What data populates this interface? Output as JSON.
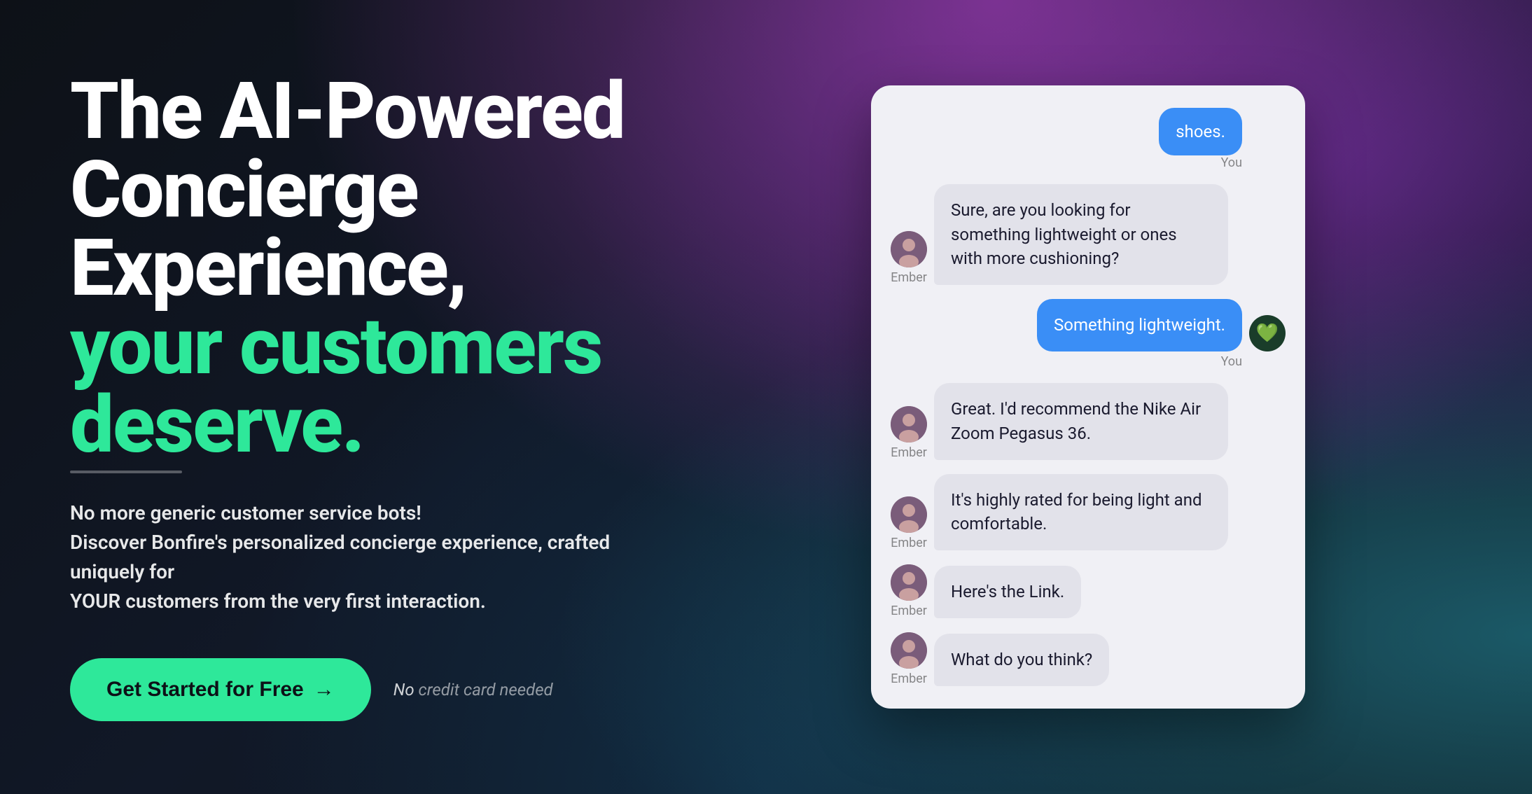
{
  "background": {
    "color": "#0d1117"
  },
  "hero": {
    "headline_line1": "The AI-Powered",
    "headline_line2": "Concierge",
    "headline_line3": "Experience,",
    "headline_green_line1": "your customers",
    "headline_green_line2": "deserve.",
    "subtext_line1": "No more generic customer service bots!",
    "subtext_line2": "Discover Bonfire's personalized concierge experience, crafted uniquely for",
    "subtext_line3": "YOUR customers from the very first interaction.",
    "cta_button_label": "Get Started for Free",
    "cta_arrow": "→",
    "no_cc_text": "No credit card needed"
  },
  "chat": {
    "messages": [
      {
        "type": "user",
        "text": "shoes.",
        "label": "You"
      },
      {
        "type": "bot",
        "text": "Sure, are you looking for something lightweight or ones with more cushioning?",
        "label": "Ember"
      },
      {
        "type": "user",
        "text": "Something lightweight.",
        "label": "You"
      },
      {
        "type": "bot",
        "text": "Great. I'd recommend the Nike Air Zoom Pegasus 36.",
        "label": "Ember"
      },
      {
        "type": "bot",
        "text": "It's highly rated for being light and comfortable.",
        "label": "Ember"
      },
      {
        "type": "bot",
        "text": "Here's the Link.",
        "label": "Ember"
      },
      {
        "type": "bot",
        "text": "What do you think?",
        "label": "Ember"
      }
    ]
  },
  "colors": {
    "accent_green": "#2ee89a",
    "dark_bg": "#0d1117",
    "chat_bg": "#f0f0f5",
    "user_bubble": "#3a8ef6",
    "bot_bubble": "#e2e2ea"
  }
}
